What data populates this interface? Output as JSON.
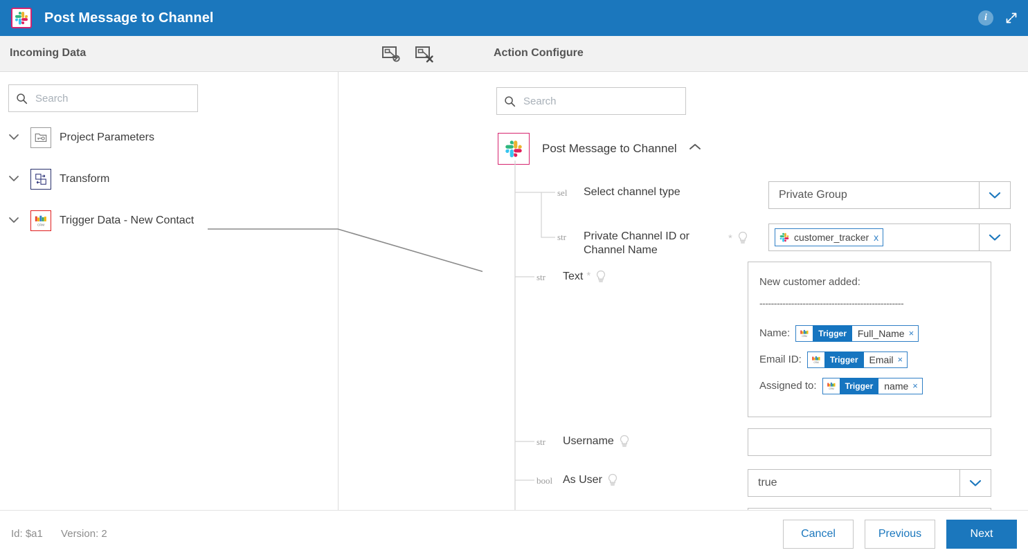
{
  "window": {
    "title": "Post Message to Channel",
    "app_icon": "slack-icon",
    "info_icon": "i",
    "expand_icon": "expand-icon"
  },
  "subheader": {
    "left_title": "Incoming Data",
    "right_title": "Action Configure",
    "tools": [
      {
        "name": "hide-mappings-icon"
      },
      {
        "name": "clear-mappings-icon"
      }
    ]
  },
  "left_panel": {
    "search": {
      "placeholder": "Search",
      "value": ""
    },
    "tree": [
      {
        "label": "Project Parameters",
        "icon": "folder-key-icon",
        "expanded": true
      },
      {
        "label": "Transform",
        "icon": "transform-icon",
        "expanded": true
      },
      {
        "label": "Trigger Data - New Contact",
        "icon": "crm-icon",
        "expanded": true
      }
    ]
  },
  "right_panel": {
    "search": {
      "placeholder": "Search",
      "value": ""
    },
    "action": {
      "name": "Post Message to Channel",
      "icon": "slack-icon",
      "collapse_icon": "chevron-up-icon"
    },
    "fields": [
      {
        "type": "sel",
        "label": "Select channel type",
        "required": false,
        "hint": true,
        "control": "select",
        "value": "Private Group"
      },
      {
        "type": "str",
        "label": "Private Channel ID or Channel Name",
        "required": true,
        "hint": true,
        "control": "select-chip",
        "chip": {
          "icon": "slack-icon",
          "text": "customer_tracker",
          "remove": "x"
        }
      },
      {
        "type": "str",
        "label": "Text",
        "required": true,
        "hint": true,
        "control": "message-editor"
      },
      {
        "type": "str",
        "label": "Username",
        "required": false,
        "hint": true,
        "control": "textinput",
        "value": ""
      },
      {
        "type": "bool",
        "label": "As User",
        "required": false,
        "hint": true,
        "control": "select",
        "value": "true"
      }
    ],
    "message_editor": {
      "line1": "New customer added:",
      "divider": "--------------------------------------------------",
      "rows": [
        {
          "label": "Name:",
          "token": {
            "icon": "crm-icon",
            "source": "Trigger",
            "field": "Full_Name",
            "remove": "×"
          }
        },
        {
          "label": "Email ID:",
          "token": {
            "icon": "crm-icon",
            "source": "Trigger",
            "field": "Email",
            "remove": "×"
          }
        },
        {
          "label": "Assigned to:",
          "token": {
            "icon": "crm-icon",
            "source": "Trigger",
            "field": "name",
            "remove": "×"
          }
        }
      ]
    }
  },
  "footer": {
    "id_label": "Id: $a1",
    "version_label": "Version: 2",
    "buttons": [
      {
        "label": "Cancel",
        "style": "outline"
      },
      {
        "label": "Previous",
        "style": "outline"
      },
      {
        "label": "Next",
        "style": "primary"
      }
    ]
  },
  "colors": {
    "titlebar": "#1b77bd",
    "accent": "#1b77bd",
    "slack_border": "#d6246e",
    "trigger_border": "#e01b1b"
  }
}
